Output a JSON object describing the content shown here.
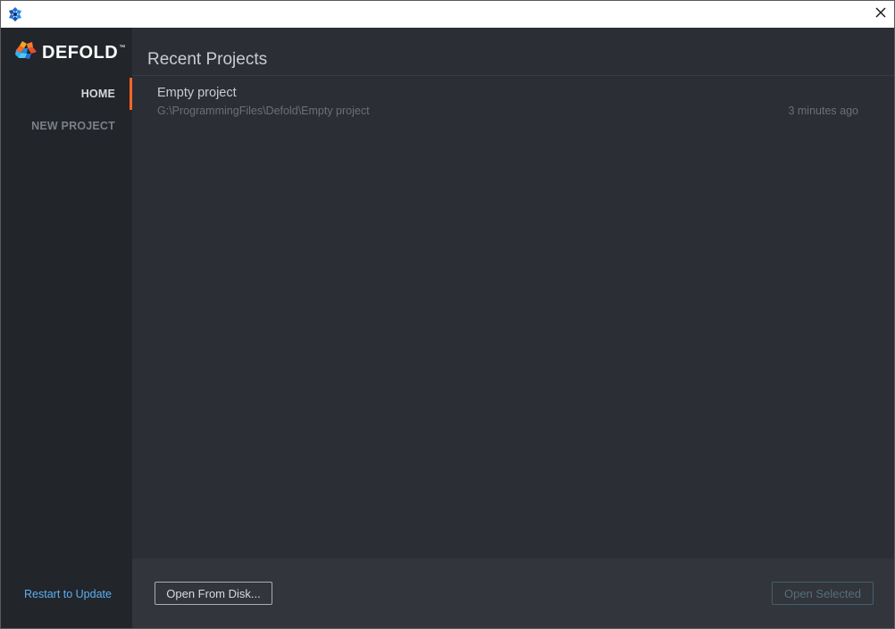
{
  "titlebar": {
    "app_icon": "defold-icon",
    "close_icon": "close-icon"
  },
  "sidebar": {
    "logo_text": "DEFOLD",
    "logo_tm": "™",
    "nav": [
      {
        "label": "HOME",
        "active": true
      },
      {
        "label": "NEW PROJECT",
        "active": false
      }
    ],
    "restart_label": "Restart to Update"
  },
  "main": {
    "title": "Recent Projects",
    "projects": [
      {
        "name": "Empty project",
        "path": "G:\\ProgrammingFiles\\Defold\\Empty project",
        "time": "3 minutes ago"
      }
    ]
  },
  "footer": {
    "open_from_disk_label": "Open From Disk...",
    "open_selected_label": "Open Selected"
  },
  "colors": {
    "accent": "#fd6623",
    "link": "#5bb0f5",
    "sidebar_bg": "#22252a",
    "main_bg": "#2b2e35"
  }
}
